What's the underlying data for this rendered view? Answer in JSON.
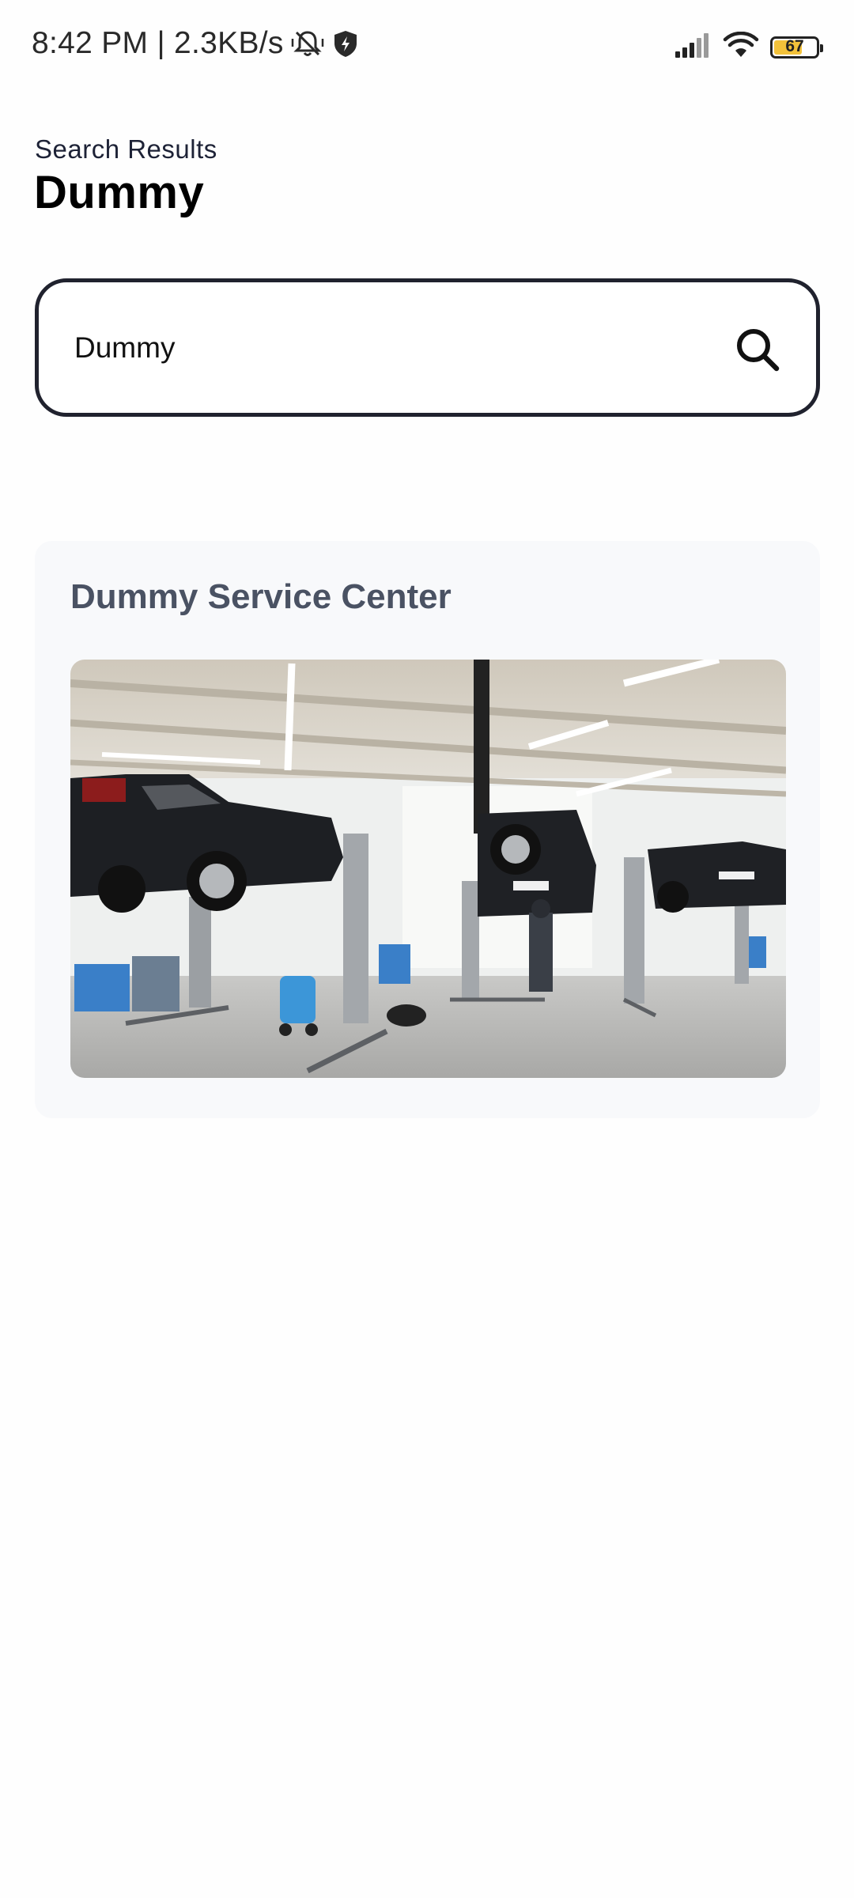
{
  "status_bar": {
    "time": "8:42 PM",
    "network_speed": "2.3KB/s",
    "battery_level": "67",
    "icons": [
      "mute-icon",
      "shield-icon",
      "signal-icon",
      "wifi-icon",
      "battery-icon"
    ]
  },
  "header": {
    "subtitle": "Search Results",
    "title": "Dummy"
  },
  "search": {
    "value": "Dummy",
    "icon": "search-icon"
  },
  "results": [
    {
      "name": "Dummy Service Center"
    }
  ],
  "colors": {
    "search_border": "#20222e",
    "card_background": "#f8f9fb",
    "card_title": "#4a5263",
    "battery_fill": "#f3c23a"
  }
}
